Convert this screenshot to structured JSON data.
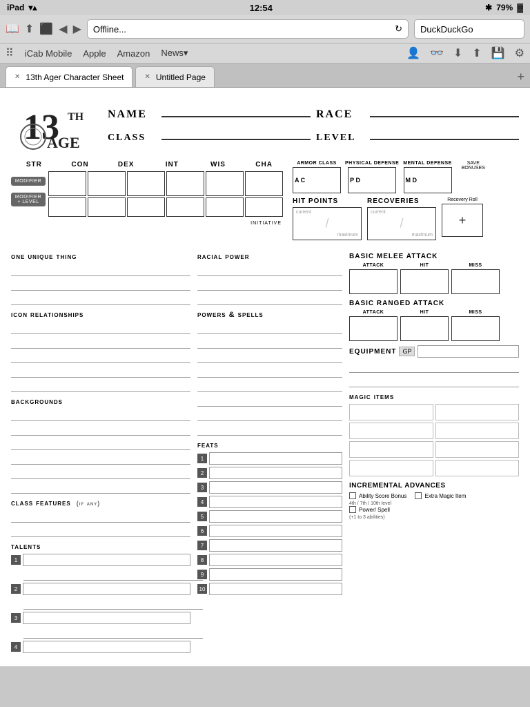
{
  "status_bar": {
    "device": "iPad",
    "wifi": "wifi",
    "time": "12:54",
    "bluetooth": "bluetooth",
    "battery": "79%"
  },
  "browser": {
    "url": "Offline...",
    "search_placeholder": "DuckDuckGo"
  },
  "nav": {
    "apps_label": "iCab Mobile",
    "items": [
      "iCab Mobile",
      "Apple",
      "Amazon",
      "News▾"
    ]
  },
  "tabs": {
    "tab1": "13th Ager Character Sheet",
    "tab2": "Untitled Page"
  },
  "sheet": {
    "name_label": "Name",
    "race_label": "Race",
    "class_label": "Class",
    "level_label": "Level",
    "ability_scores": {
      "headers": [
        "STR",
        "CON",
        "DEX",
        "INT",
        "WIS",
        "CHA"
      ],
      "modifier_label": "MODIFIER",
      "modifier_level_label": "MODIFIER + LEVEL",
      "initiative_label": "INITIATIVE"
    },
    "defenses": {
      "armor_class": "ARMOR CLASS",
      "ac_abbr": "A C",
      "physical_defense": "PHYSICAL DEFENSE",
      "pd_abbr": "P D",
      "mental_defense": "MENTAL DEFENSE",
      "md_abbr": "M D",
      "save_bonuses": "SAVE BONUSES"
    },
    "hit_points": {
      "label": "HIT POINTS",
      "current": "current",
      "maximum": "maximum"
    },
    "recoveries": {
      "label": "RECOVERIES",
      "current": "current",
      "maximum": "maximum"
    },
    "recovery_roll": {
      "label": "Recovery Roll",
      "plus": "+"
    },
    "sections": {
      "one_unique_thing": "ONE UNIQUE THING",
      "icon_relationships": "ICON RELATIONSHIPS",
      "backgrounds": "BACKGROUNDS",
      "class_features": "CLASS FEATURES",
      "class_features_note": "(if any)",
      "talents": "TALENTS",
      "racial_power": "RACIAL POWER",
      "powers_spells": "POWERS & SPELLS",
      "feats": "FEATS",
      "basic_melee_attack": "BASIC MELEE ATTACK",
      "basic_ranged_attack": "BASIC RANGED ATTACK",
      "equipment": "EQUIPMENT",
      "gp": "GP",
      "magic_items": "MAGIC ITEMS",
      "incremental_advances": "INCREMENTAL ADVANCES"
    },
    "attack_labels": {
      "attack": "ATTACK",
      "hit": "HIT",
      "miss": "MISS"
    },
    "feats_numbers": [
      "1",
      "2",
      "3",
      "4",
      "5",
      "6",
      "7",
      "8",
      "9",
      "10"
    ],
    "talents_numbers": [
      "1",
      "2",
      "3",
      "4"
    ],
    "incremental": {
      "ability_score_bonus": "Ability Score Bonus",
      "extra_magic_item": "Extra Magic Item",
      "level_note": "4th / 7th / 10th level",
      "power_spell": "Power/ Spell",
      "abilities_note": "(+1 to 3 abilities)"
    }
  }
}
